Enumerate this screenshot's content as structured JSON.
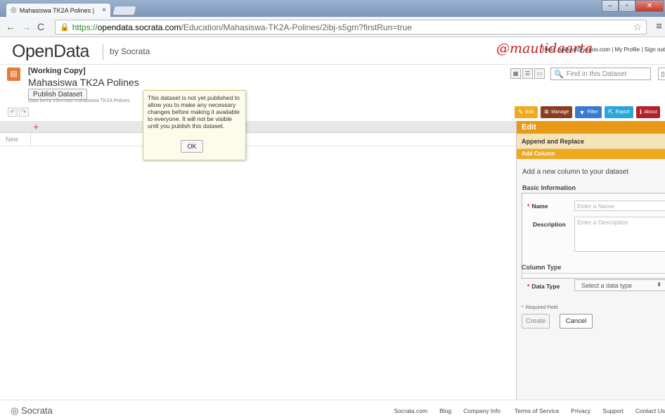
{
  "browser": {
    "tab_title": "Mahasiswa TK2A Polines |",
    "tab_close": "×",
    "url_https": "https://",
    "url_host": "opendata.socrata.com",
    "url_path": "/Education/Mahasiswa-TK2A-Polines/2ibj-s5gm?firstRun=true"
  },
  "header": {
    "logo": "OpenData",
    "by": "by Socrata",
    "watermark": "@mautidaarta",
    "user_actions": "Hello, aplikasi@yahoo.com | My Profile | Sign out"
  },
  "dataset": {
    "working_copy": "[Working Copy]",
    "title": "Mahasiswa TK2A Polines",
    "publish_label": "Publish Dataset",
    "description": "Data berisi informasi mahasiswa TK2A Polines",
    "find_placeholder": "Find in this Dataset"
  },
  "actions": {
    "edit": "Edit",
    "manage": "Manage",
    "filter": "Filter",
    "export": "Export",
    "about": "About"
  },
  "grid": {
    "add_column": "+",
    "new_row": "New"
  },
  "tooltip": {
    "text": "This dataset is not yet published to allow you to make any necessary changes before making it available to everyone. It will not be visible until you publish this dataset.",
    "ok": "OK"
  },
  "panel": {
    "title": "Edit",
    "append": "Append and Replace",
    "add_column": "Add Column",
    "intro": "Add a new column to your dataset",
    "basic_info": "Basic Information",
    "name_label": "Name",
    "name_placeholder": "Enter a Name",
    "description_label": "Description",
    "description_placeholder": "Enter a Description",
    "column_type": "Column Type",
    "data_type_label": "Data Type",
    "data_type_value": "Select a data type",
    "required_note": "Required Field",
    "create": "Create",
    "cancel": "Cancel"
  },
  "footer": {
    "logo": "Socrata",
    "links": [
      "Socrata.com",
      "Blog",
      "Company Info",
      "Terms of Service",
      "Privacy",
      "Support",
      "Contact Us"
    ]
  }
}
